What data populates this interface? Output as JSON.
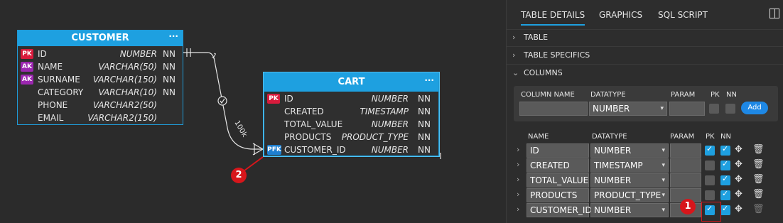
{
  "customer": {
    "title": "CUSTOMER",
    "more": "···",
    "rows": [
      {
        "badge": "PK",
        "name": "ID",
        "type": "NUMBER",
        "nn": "NN"
      },
      {
        "badge": "AK",
        "name": "NAME",
        "type": "VARCHAR(50)",
        "nn": "NN"
      },
      {
        "badge": "AK",
        "name": "SURNAME",
        "type": "VARCHAR(150)",
        "nn": "NN"
      },
      {
        "badge": "",
        "name": "CATEGORY",
        "type": "VARCHAR(10)",
        "nn": "NN"
      },
      {
        "badge": "",
        "name": "PHONE",
        "type": "VARCHAR2(50)",
        "nn": ""
      },
      {
        "badge": "",
        "name": "EMAIL",
        "type": "VARCHAR2(150)",
        "nn": ""
      }
    ]
  },
  "cart": {
    "title": "CART",
    "more": "···",
    "rows": [
      {
        "badge": "PK",
        "name": "ID",
        "type": "NUMBER",
        "nn": "NN"
      },
      {
        "badge": "",
        "name": "CREATED",
        "type": "TIMESTAMP",
        "nn": "NN"
      },
      {
        "badge": "",
        "name": "TOTAL_VALUE",
        "type": "NUMBER",
        "nn": "NN"
      },
      {
        "badge": "",
        "name": "PRODUCTS",
        "type": "PRODUCT_TYPE",
        "nn": "NN"
      },
      {
        "badge": "PFK",
        "name": "CUSTOMER_ID",
        "type": "NUMBER",
        "nn": "NN"
      }
    ]
  },
  "relation": {
    "one": "1",
    "many": "100k"
  },
  "markers": {
    "one": "1",
    "two": "2"
  },
  "tabs": [
    "TABLE DETAILS",
    "GRAPHICS",
    "SQL SCRIPT"
  ],
  "sections": [
    "TABLE",
    "TABLE SPECIFICS",
    "COLUMNS"
  ],
  "new_column": {
    "label_name": "COLUMN NAME",
    "label_datatype": "DATATYPE",
    "label_param": "PARAM",
    "label_pk": "PK",
    "label_nn": "NN",
    "datatype": "NUMBER",
    "add": "Add"
  },
  "columns_header": {
    "name": "NAME",
    "datatype": "DATATYPE",
    "param": "PARAM",
    "pk": "PK",
    "nn": "NN"
  },
  "columns": [
    {
      "name": "ID",
      "datatype": "NUMBER",
      "pk": true,
      "nn": true
    },
    {
      "name": "CREATED",
      "datatype": "TIMESTAMP",
      "pk": false,
      "nn": true
    },
    {
      "name": "TOTAL_VALUE",
      "datatype": "NUMBER",
      "pk": false,
      "nn": true
    },
    {
      "name": "PRODUCTS",
      "datatype": "PRODUCT_TYPE",
      "pk": false,
      "nn": true
    },
    {
      "name": "CUSTOMER_ID",
      "datatype": "NUMBER",
      "pk": true,
      "nn": true
    }
  ],
  "icons": {
    "expand": "chevron-right-icon",
    "collapse": "chevron-down-icon",
    "move": "move-icon",
    "delete": "trash-icon",
    "layout": "split-panel-icon"
  },
  "colors": {
    "accent": "#1ea0e0",
    "pk": "#d81b3c",
    "ak": "#9c27b0",
    "pfk": "#1e7fd0",
    "marker": "#d7161b"
  }
}
